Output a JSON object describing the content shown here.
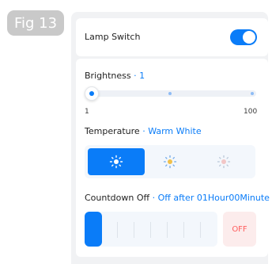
{
  "figure_label": "Fig 13",
  "lamp": {
    "label": "Lamp Switch",
    "on": true
  },
  "brightness": {
    "label": "Brightness",
    "separator": "·",
    "value": "1",
    "min_label": "1",
    "max_label": "100"
  },
  "temperature": {
    "label": "Temperature",
    "separator": "·",
    "value": "Warm White",
    "options": [
      {
        "icon": "sun-icon",
        "selected": true
      },
      {
        "icon": "sun-icon",
        "selected": false
      },
      {
        "icon": "sun-icon",
        "selected": false
      }
    ]
  },
  "countdown": {
    "label": "Countdown Off",
    "separator": "·",
    "value": "Off after 01Hour00Minute",
    "off_label": "OFF"
  },
  "colors": {
    "accent": "#0a7cf8",
    "off_text": "#ff5d5d",
    "off_bg": "#fcecec"
  }
}
